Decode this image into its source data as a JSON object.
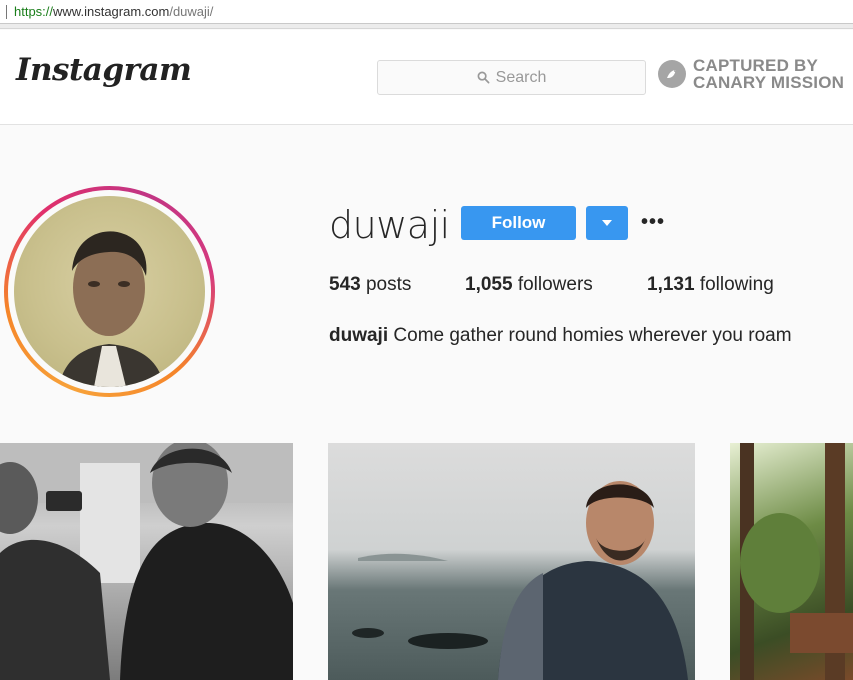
{
  "browser": {
    "url_scheme": "https://",
    "url_host": "www.instagram.com",
    "url_path": "/duwaji/"
  },
  "header": {
    "logo": "Instagram",
    "search_placeholder": "Search",
    "watermark_line1": "CAPTURED BY",
    "watermark_line2": "CANARY MISSION"
  },
  "profile": {
    "username": "duwaji",
    "follow_label": "Follow",
    "more_label": "•••",
    "stats": [
      {
        "count": "543",
        "label": "posts"
      },
      {
        "count": "1,055",
        "label": "followers"
      },
      {
        "count": "1,131",
        "label": "following"
      }
    ],
    "bio_name": "duwaji",
    "bio_text": "Come gather round homies wherever you roam"
  },
  "colors": {
    "accent": "#3897f0",
    "watermark": "#8a8a8a"
  },
  "icons": [
    "search-icon",
    "dropdown-arrow-icon",
    "canary-bird-icon"
  ]
}
